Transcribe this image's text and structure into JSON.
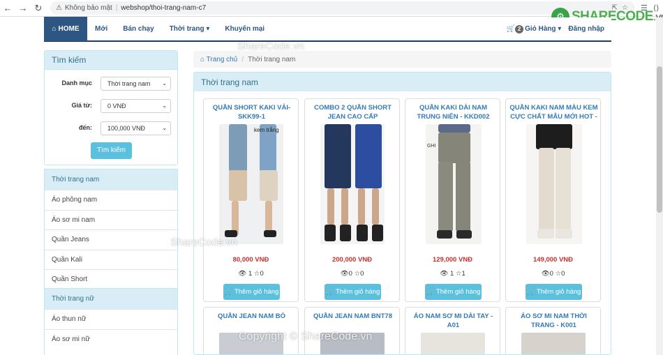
{
  "browser": {
    "security": "Không bảo mật",
    "url": "webshop/thoi-trang-nam-c7"
  },
  "watermark_logo": {
    "brand": "SHARECODE",
    "tld": ".vn"
  },
  "watermarks": [
    "ShareCode.vn",
    "ShareCode.vn",
    "Copyright © ShareCode.vn"
  ],
  "navbar": {
    "home": "HOME",
    "items": [
      "Mới",
      "Bán chạy",
      "Thời trang",
      "Khuyến mại"
    ],
    "cart_count": "2",
    "cart_label": "Giỏ Hàng",
    "login": "Đăng nhập"
  },
  "search": {
    "title": "Tìm kiếm",
    "category_label": "Danh mục",
    "category_value": "Thời trang nam",
    "from_label": "Giá từ:",
    "from_value": "0 VNĐ",
    "to_label": "đến:",
    "to_value": "100,000 VNĐ",
    "button": "Tìm kiếm"
  },
  "categories": [
    {
      "title": "Thời trang nam",
      "items": [
        "Áo phông nam",
        "Áo sơ mi nam",
        "Quần Jeans",
        "Quần Kali",
        "Quần Short"
      ]
    },
    {
      "title": "Thời trang nữ",
      "items": [
        "Áo thun nữ",
        "Áo sơ mi nữ"
      ]
    }
  ],
  "breadcrumb": {
    "home": "Trang chủ",
    "current": "Thời trang nam"
  },
  "products_title": "Thời trang nam",
  "add_to_cart": "Thêm giỏ hàng",
  "products": [
    {
      "title": "QUẦN SHORT KAKI VẢI- SKK99-1",
      "price": "80,000 VNĐ",
      "views": "1",
      "stars": "0",
      "photo_note": "kem trắng"
    },
    {
      "title": "COMBO 2 QUẦN SHORT JEAN CAO CẤP",
      "price": "200,000 VNĐ",
      "views": "0",
      "stars": "0",
      "photo_note": ""
    },
    {
      "title": "QUẦN KAKI DÀI NAM TRUNG NIÊN - KKD002",
      "price": "129,000 VNĐ",
      "views": "1",
      "stars": "1",
      "photo_note": "GHI"
    },
    {
      "title": "QUẦN KAKI NAM MÀU KEM CỰC CHẤT MẪU MỚI HOT -",
      "price": "149,000 VNĐ",
      "views": "0",
      "stars": "0",
      "photo_note": ""
    }
  ],
  "products_row2": [
    {
      "title": "QUẦN JEAN NAM BÒ"
    },
    {
      "title": "QUẦN JEAN NAM BNT78"
    },
    {
      "title": "ÁO NAM SƠ MI DÀI TAY - A01"
    },
    {
      "title": "ÁO SƠ MI NAM THỜI TRANG - K001"
    }
  ],
  "colors": {
    "primary": "#2d5683",
    "info": "#5bc0de",
    "panel": "#d9edf7",
    "price": "#c9302c",
    "link": "#337ab7"
  }
}
